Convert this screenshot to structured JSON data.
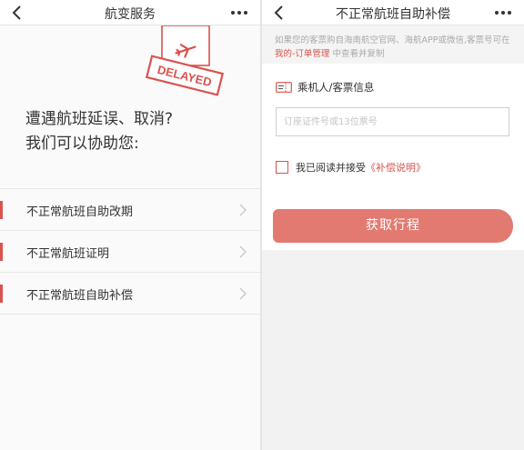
{
  "left_screen": {
    "nav_title": "航变服务",
    "illustration_stamp": "DELAYED",
    "headline_line1": "遭遇航班延误、取消?",
    "headline_line2": "我们可以协助您:",
    "menu_items": [
      {
        "label": "不正常航班自助改期"
      },
      {
        "label": "不正常航班证明"
      },
      {
        "label": "不正常航班自助补偿"
      }
    ]
  },
  "right_screen": {
    "nav_title": "不正常航班自助补偿",
    "notice_text_1": "如果您的客票购自海南航空官网、海航APP或微信,客票号可在",
    "notice_link": "我的-订单管理",
    "notice_text_2": "中查看并复制",
    "section_title": "乘机人/客票信息",
    "id_input": {
      "value": "",
      "placeholder": "订座证件号或13位票号"
    },
    "agree_text": "我已阅读并接受",
    "agree_link": "《补偿说明》",
    "submit_label": "获取行程"
  },
  "colors": {
    "accent": "#d9534f",
    "button": "#e37a72",
    "background": "#f2f2f2"
  },
  "icons": [
    "back-arrow-icon",
    "more-dots-icon",
    "chevron-right-icon",
    "boarding-pass-icon",
    "airplane-icon"
  ]
}
